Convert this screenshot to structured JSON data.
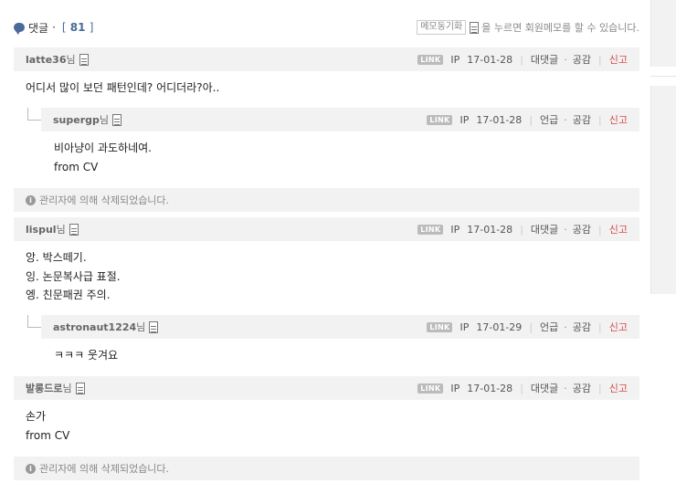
{
  "header": {
    "title": "댓글",
    "separator": "·",
    "count_open": "[",
    "count": "81",
    "count_close": "]",
    "memo_button": "메모동기화",
    "memo_text": "을 누르면 회원메모를 할 수 있습니다."
  },
  "comments": [
    {
      "author": "latte36",
      "suffix": "님",
      "link": "LINK",
      "ip": "IP",
      "date": "17-01-28",
      "action": "대댓글",
      "like": "공감",
      "report": "신고",
      "lines": [
        "어디서 많이 보던 패턴인데? 어디더라?아.."
      ]
    },
    {
      "author": "supergp",
      "suffix": "님",
      "link": "LINK",
      "ip": "IP",
      "date": "17-01-28",
      "action": "언급",
      "like": "공감",
      "report": "신고",
      "lines": [
        "비아냥이 과도하네여.",
        "from CV"
      ]
    },
    {
      "author": "lispul",
      "suffix": "님",
      "link": "LINK",
      "ip": "IP",
      "date": "17-01-28",
      "action": "대댓글",
      "like": "공감",
      "report": "신고",
      "lines": [
        "앙. 박스떼기.",
        "잉. 논문복사급 표절.",
        "엥. 친문패권 주의."
      ]
    },
    {
      "author": "astronaut1224",
      "suffix": "님",
      "link": "LINK",
      "ip": "IP",
      "date": "17-01-29",
      "action": "언급",
      "like": "공감",
      "report": "신고",
      "lines": [
        "ㅋㅋㅋ 웃겨요"
      ]
    },
    {
      "author": "발롱드로",
      "suffix": "님",
      "link": "LINK",
      "ip": "IP",
      "date": "17-01-28",
      "action": "대댓글",
      "like": "공감",
      "report": "신고",
      "lines": [
        "손가",
        "from CV"
      ]
    }
  ],
  "deleted_notice": "관리자에 의해 삭제되었습니다.",
  "icons": {
    "comment": "speech-bubble-icon",
    "memo": "document-icon",
    "info": "info-icon"
  }
}
